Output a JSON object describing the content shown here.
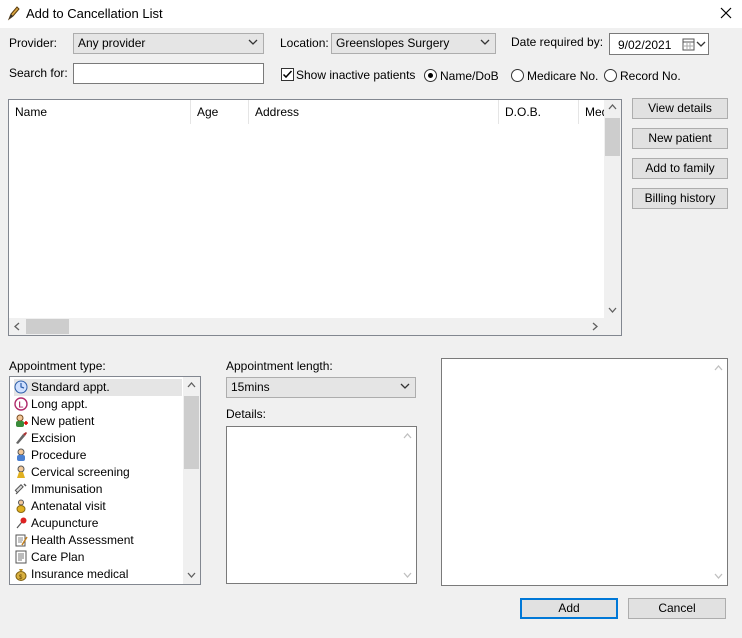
{
  "window": {
    "title": "Add to Cancellation List"
  },
  "filters": {
    "provider_label": "Provider:",
    "provider_value": "Any provider",
    "location_label": "Location:",
    "location_value": "Greenslopes Surgery",
    "date_label": "Date required by:",
    "date_value": "9/02/2021",
    "search_label": "Search for:",
    "search_value": "",
    "show_inactive_label": "Show inactive patients",
    "show_inactive_checked": true,
    "search_modes": [
      "Name/DoB",
      "Medicare No.",
      "Record No."
    ],
    "selected_mode": "Name/DoB"
  },
  "patients_table": {
    "columns": [
      "Name",
      "Age",
      "Address",
      "D.O.B.",
      "Med"
    ],
    "rows": []
  },
  "side_buttons": [
    "View details",
    "New patient",
    "Add to family",
    "Billing history"
  ],
  "appointment_type": {
    "label": "Appointment type:",
    "items": [
      {
        "label": "Standard appt.",
        "icon": "clock-icon",
        "selected": true
      },
      {
        "label": "Long appt.",
        "icon": "long-clock-icon"
      },
      {
        "label": "New patient",
        "icon": "new-patient-icon"
      },
      {
        "label": "Excision",
        "icon": "scalpel-icon"
      },
      {
        "label": "Procedure",
        "icon": "procedure-icon"
      },
      {
        "label": "Cervical screening",
        "icon": "female-icon"
      },
      {
        "label": "Immunisation",
        "icon": "syringe-icon"
      },
      {
        "label": "Antenatal visit",
        "icon": "antenatal-icon"
      },
      {
        "label": "Acupuncture",
        "icon": "pin-icon"
      },
      {
        "label": "Health Assessment",
        "icon": "clipboard-icon"
      },
      {
        "label": "Care Plan",
        "icon": "document-icon"
      },
      {
        "label": "Insurance medical",
        "icon": "moneybag-icon"
      }
    ]
  },
  "appointment_length": {
    "label": "Appointment length:",
    "value": "15mins"
  },
  "details": {
    "label": "Details:",
    "value": ""
  },
  "actions": {
    "add": "Add",
    "cancel": "Cancel"
  }
}
